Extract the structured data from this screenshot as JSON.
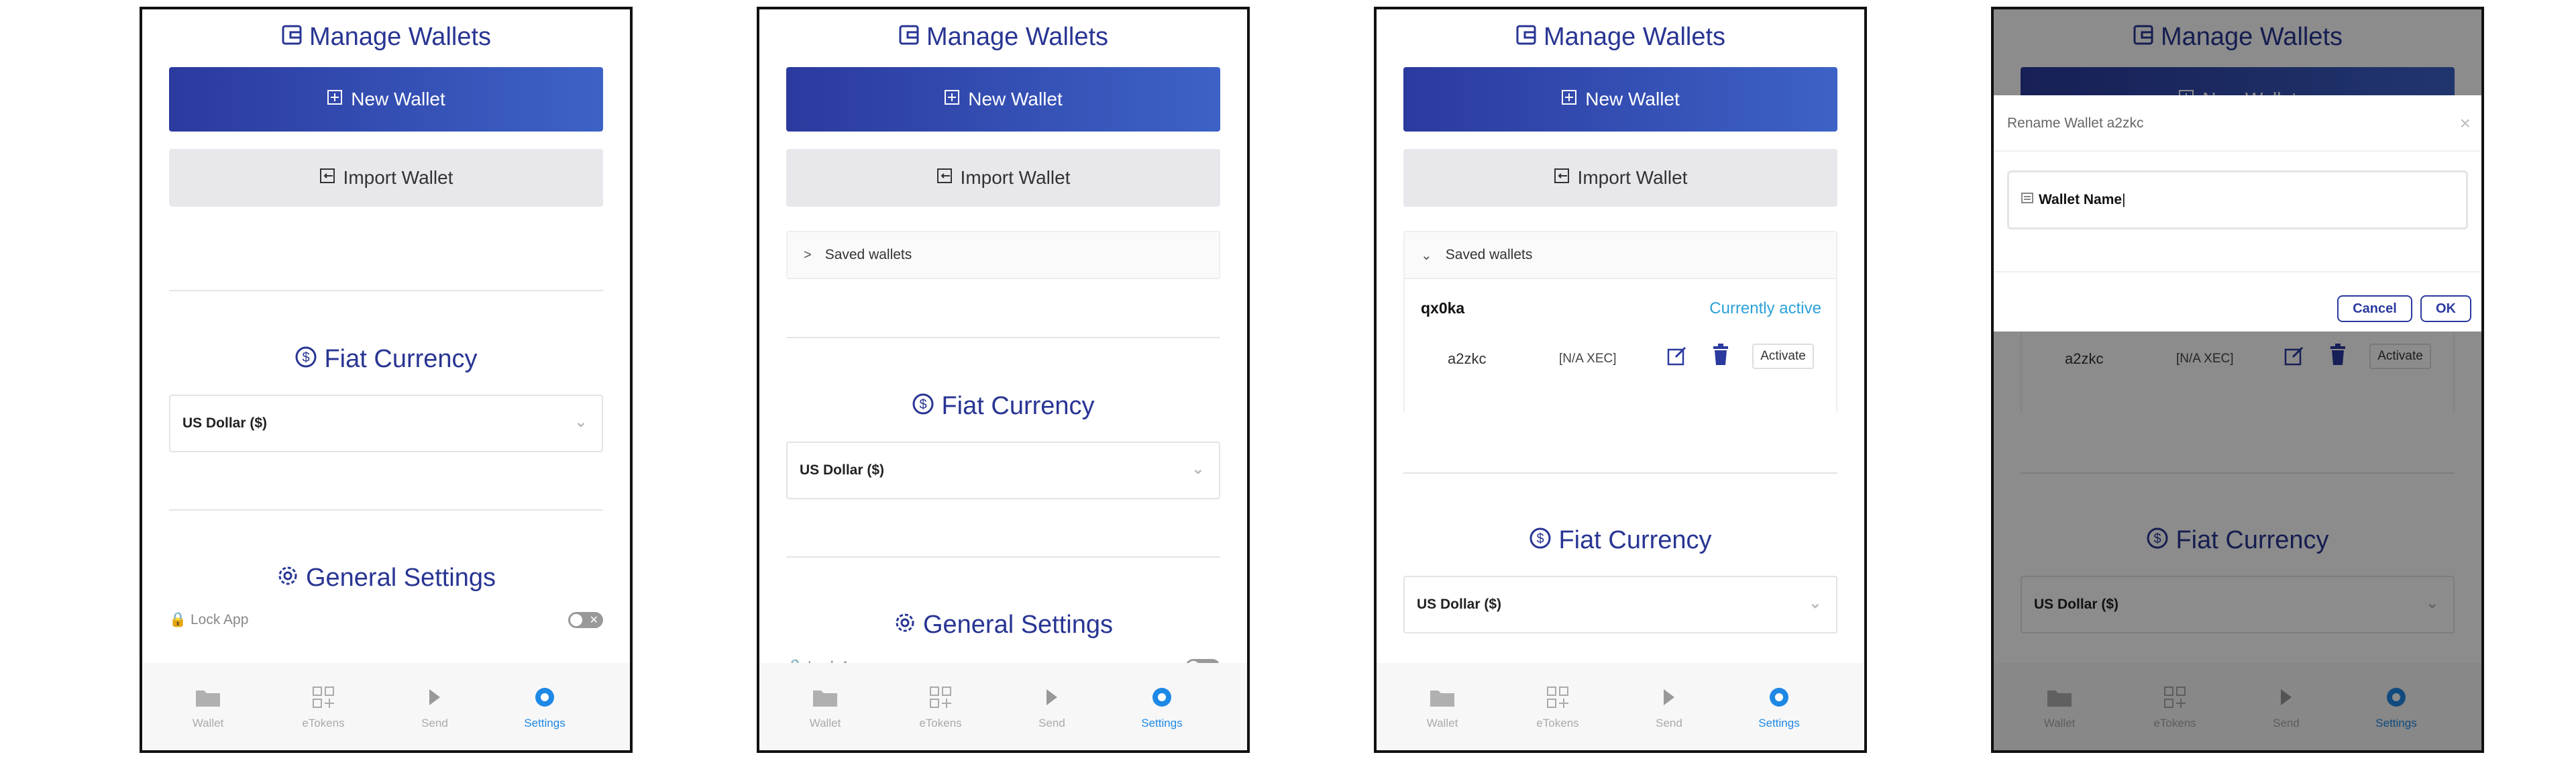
{
  "colors": {
    "accent": "#283593",
    "nav_active": "#1e88e5",
    "currently_active": "#2aa1d8"
  },
  "manage_wallets": {
    "title": "Manage Wallets",
    "new_wallet": "New Wallet",
    "import_wallet": "Import Wallet"
  },
  "saved_wallets": {
    "label": "Saved wallets",
    "active_wallet": "qx0ka",
    "currently_active": "Currently active",
    "wallet_name": "a2zkc",
    "wallet_balance": "[N/A XEC]",
    "activate": "Activate"
  },
  "fiat": {
    "title": "Fiat Currency",
    "selected": "US Dollar ($)"
  },
  "general": {
    "title": "General Settings",
    "lock_app": "Lock App"
  },
  "nav": {
    "wallet": "Wallet",
    "etokens": "eTokens",
    "send": "Send",
    "settings": "Settings"
  },
  "rename_modal": {
    "title": "Rename Wallet a2zkc",
    "input_value": "Wallet Name",
    "cancel": "Cancel",
    "ok": "OK"
  }
}
